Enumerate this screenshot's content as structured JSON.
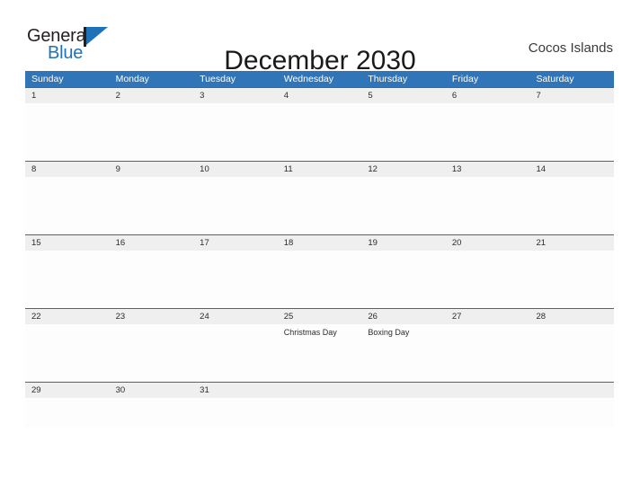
{
  "brand": {
    "word_one": "General",
    "word_two": "Blue",
    "logo_icon": "blue-triangle-flag-icon",
    "colors": {
      "black": "#231f20",
      "blue": "#1f72b8"
    }
  },
  "header": {
    "title": "December 2030",
    "locale": "Cocos Islands"
  },
  "theme": {
    "header_blue": "#3075b8",
    "separator_blue": "#2e6da4",
    "band_gray": "#efefef",
    "page_background": "#ffffff"
  },
  "calendar": {
    "month": "December",
    "year": "2030",
    "weekdays": [
      "Sunday",
      "Monday",
      "Tuesday",
      "Wednesday",
      "Thursday",
      "Friday",
      "Saturday"
    ],
    "weeks": [
      {
        "days": [
          {
            "num": "1",
            "events": []
          },
          {
            "num": "2",
            "events": []
          },
          {
            "num": "3",
            "events": []
          },
          {
            "num": "4",
            "events": []
          },
          {
            "num": "5",
            "events": []
          },
          {
            "num": "6",
            "events": []
          },
          {
            "num": "7",
            "events": []
          }
        ]
      },
      {
        "days": [
          {
            "num": "8",
            "events": []
          },
          {
            "num": "9",
            "events": []
          },
          {
            "num": "10",
            "events": []
          },
          {
            "num": "11",
            "events": []
          },
          {
            "num": "12",
            "events": []
          },
          {
            "num": "13",
            "events": []
          },
          {
            "num": "14",
            "events": []
          }
        ]
      },
      {
        "days": [
          {
            "num": "15",
            "events": []
          },
          {
            "num": "16",
            "events": []
          },
          {
            "num": "17",
            "events": []
          },
          {
            "num": "18",
            "events": []
          },
          {
            "num": "19",
            "events": []
          },
          {
            "num": "20",
            "events": []
          },
          {
            "num": "21",
            "events": []
          }
        ]
      },
      {
        "days": [
          {
            "num": "22",
            "events": []
          },
          {
            "num": "23",
            "events": []
          },
          {
            "num": "24",
            "events": []
          },
          {
            "num": "25",
            "events": [
              "Christmas Day"
            ]
          },
          {
            "num": "26",
            "events": [
              "Boxing Day"
            ]
          },
          {
            "num": "27",
            "events": []
          },
          {
            "num": "28",
            "events": []
          }
        ]
      },
      {
        "days": [
          {
            "num": "29",
            "events": []
          },
          {
            "num": "30",
            "events": []
          },
          {
            "num": "31",
            "events": []
          },
          {
            "num": "",
            "events": []
          },
          {
            "num": "",
            "events": []
          },
          {
            "num": "",
            "events": []
          },
          {
            "num": "",
            "events": []
          }
        ]
      }
    ]
  }
}
